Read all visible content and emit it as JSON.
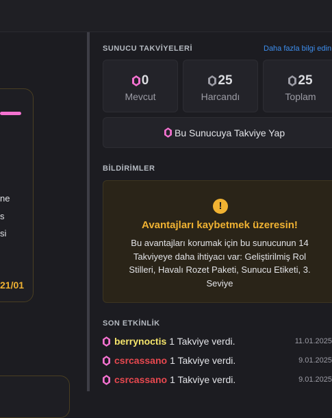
{
  "left": {
    "lines": [
      "ne",
      "s",
      "si"
    ],
    "date": "21/01"
  },
  "boosts": {
    "title": "SUNUCU TAKVİYELERİ",
    "learn_more": "Daha fazla bilgi edin",
    "stats": [
      {
        "value": "0",
        "label": "Mevcut",
        "gem_color": "#f472d0"
      },
      {
        "value": "25",
        "label": "Harcandı",
        "gem_color": "#9c9ca5"
      },
      {
        "value": "25",
        "label": "Toplam",
        "gem_color": "#9c9ca5"
      }
    ],
    "boost_button": "Bu Sunucuya Takviye Yap"
  },
  "notifications": {
    "title": "BİLDİRİMLER",
    "warning_icon": "!",
    "warning_title": "Avantajları kaybetmek üzeresin!",
    "warning_body": "Bu avantajları korumak için bu sunucunun 14 Takviyeye daha ihtiyacı var: Geliştirilmiş Rol Stilleri, Havalı Rozet Paketi, Sunucu Etiketi, 3. Seviye"
  },
  "activity": {
    "title": "SON ETKİNLİK",
    "items": [
      {
        "name": "berrynoctis",
        "name_color": "#f5e56b",
        "text": "1 Takviye verdi.",
        "date": "11.01.2025"
      },
      {
        "name": "csrcassano",
        "name_color": "#e8484f",
        "text": "1 Takviye verdi.",
        "date": "9.01.2025"
      },
      {
        "name": "csrcassano",
        "name_color": "#e8484f",
        "text": "1 Takviye verdi.",
        "date": "9.01.2025"
      }
    ]
  },
  "colors": {
    "accent_pink": "#f472d0",
    "warning": "#f0b232",
    "link": "#3d8ff0"
  }
}
